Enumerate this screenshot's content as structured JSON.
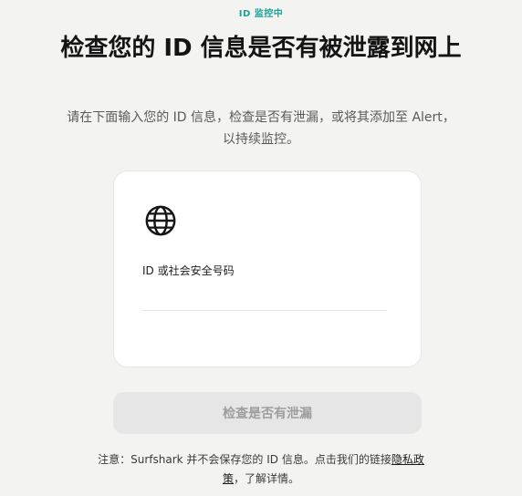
{
  "header": {
    "eyebrow": "ID 监控中",
    "title": "检查您的 ID 信息是否有被泄露到网上",
    "subtitle": "请在下面输入您的 ID 信息，检查是否有泄漏，或将其添加至 Alert，以持续监控。"
  },
  "form": {
    "icon": "globe-icon",
    "field_label": "ID 或社会安全号码",
    "field_value": "",
    "field_placeholder": "",
    "submit_label": "检查是否有泄漏"
  },
  "notice": {
    "prefix": "注意：Surfshark 并不会保存您的 ID 信息。点击我们的链接",
    "link": "隐私政策",
    "suffix": "，了解详情。"
  },
  "colors": {
    "accent": "#1aa39a",
    "background": "#f3f3f2",
    "card": "#ffffff",
    "button_disabled_bg": "#e6e6e6",
    "button_disabled_text": "#9d9d9d"
  }
}
